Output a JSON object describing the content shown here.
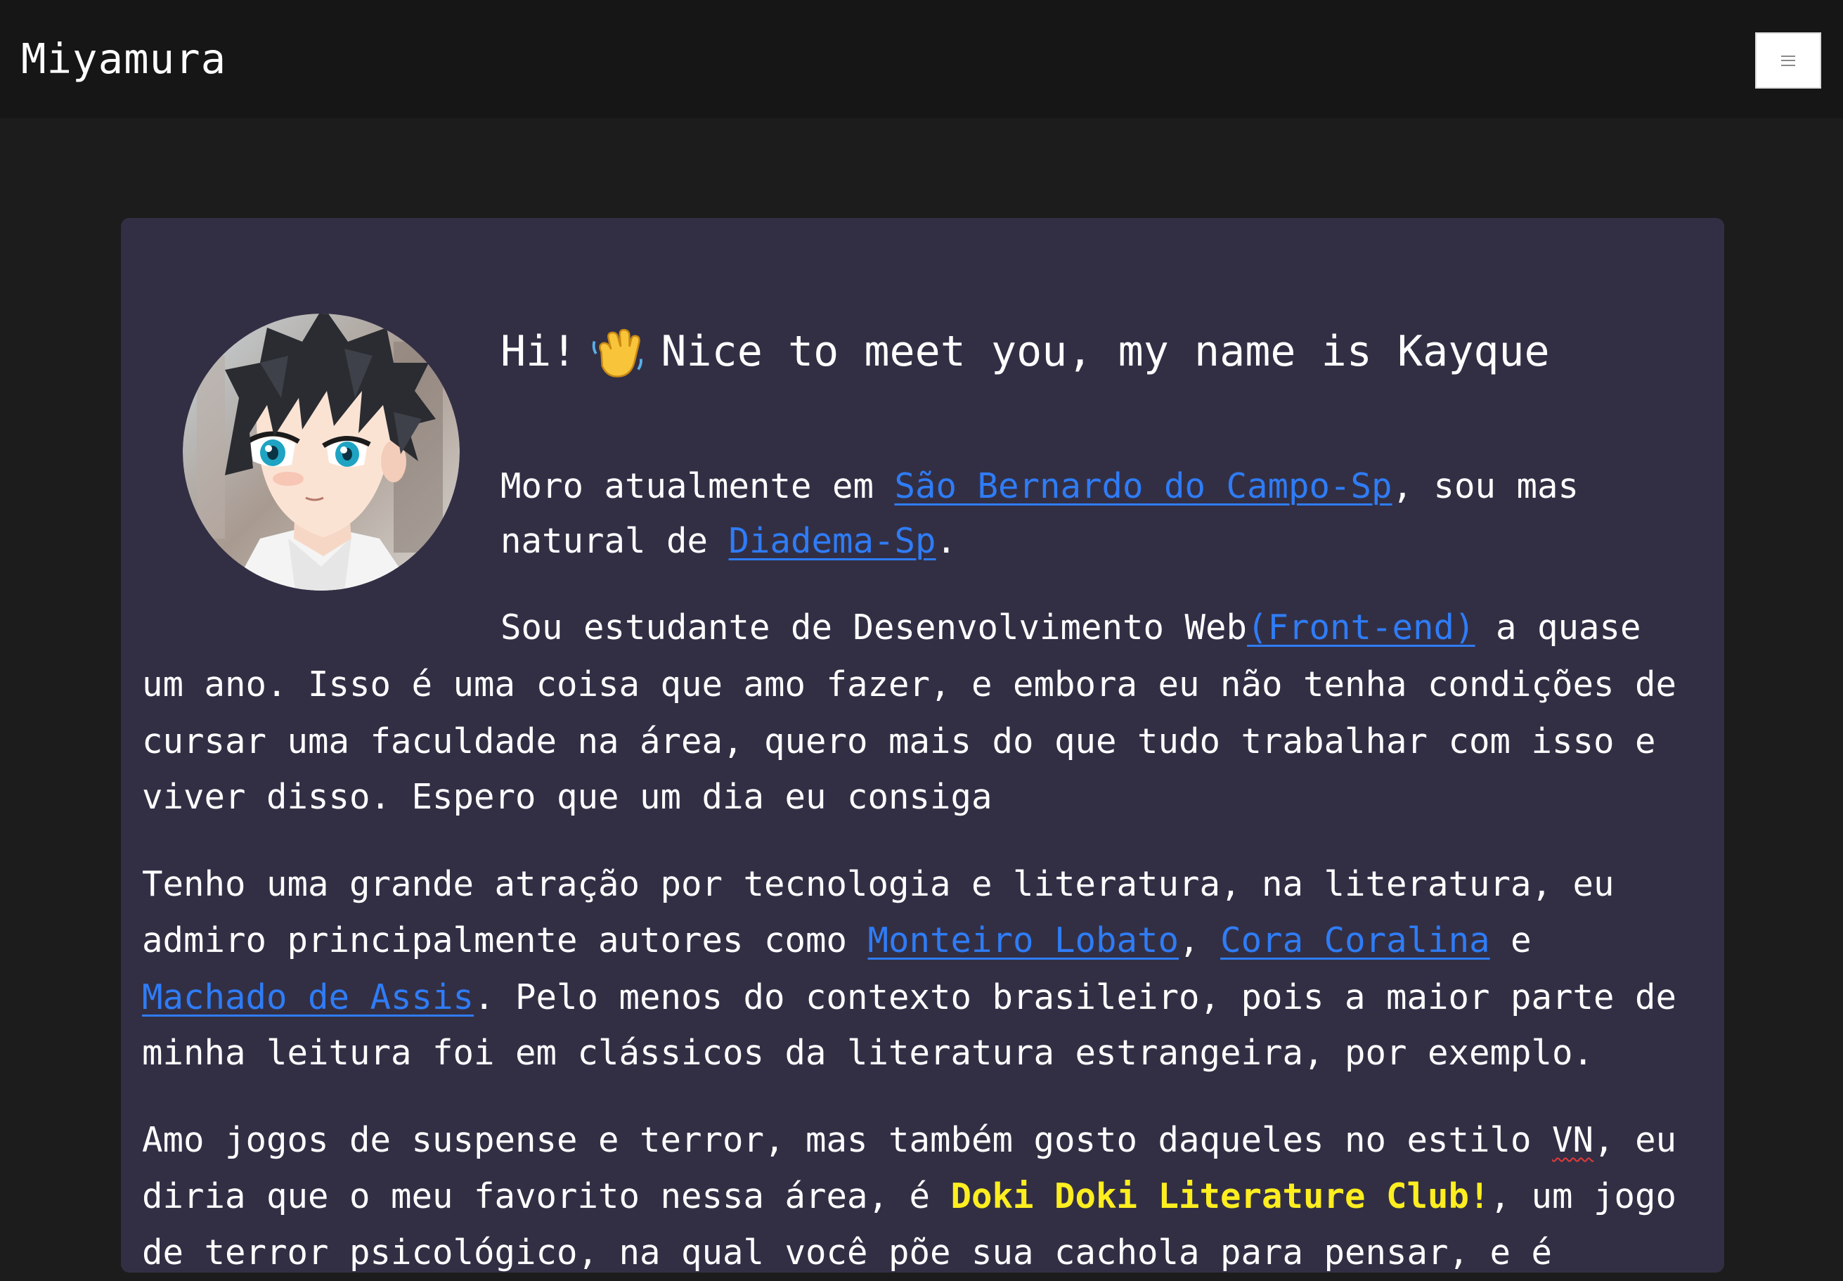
{
  "header": {
    "brand": "Miyamura",
    "menu_icon": "hamburger-icon"
  },
  "profile": {
    "avatar_icon": "anime-avatar",
    "greeting_pre": "Hi!",
    "greeting_emoji": "waving-hand-icon",
    "greeting_post": "Nice to meet you, my name is Kayque"
  },
  "intro": {
    "t1": "Moro atualmente em ",
    "link1": "São Bernardo do Campo-Sp",
    "t2": ", sou mas",
    "t3": "natural de ",
    "link2": "Diadema-Sp",
    "t4": "."
  },
  "study": {
    "t1": "Sou estudante de Desenvolvimento Web",
    "link": "(Front-end)",
    "t2": " a quase",
    "line2": "um ano. Isso é uma coisa que amo fazer, e embora eu não tenha condições de",
    "line3": "cursar uma faculdade na área, quero mais do que tudo trabalhar com isso e",
    "line4": "viver disso. Espero que um dia eu consiga"
  },
  "literature": {
    "line1": "Tenho uma grande atração por tecnologia e literatura, na literatura, eu",
    "t1": "admiro principalmente autores como ",
    "link1": "Monteiro Lobato",
    "t2": ", ",
    "link2": "Cora Coralina",
    "t3": " e",
    "link3": "Machado de Assis",
    "t4": ". Pelo menos do contexto brasileiro, pois a maior parte de",
    "line4": "minha leitura foi em clássicos da literatura estrangeira, por exemplo."
  },
  "games": {
    "t1": "Amo jogos de suspense e terror, mas também gosto daqueles no estilo ",
    "vn": "VN",
    "t2": ", eu",
    "t3": "diria que o meu favorito nessa área, é ",
    "game": "Doki Doki Literature Club!",
    "t4": ", um jogo",
    "line3": "de terror psicológico, na qual você põe sua cachola para pensar, e é"
  },
  "colors": {
    "link": "#2f7cf6",
    "highlight": "#ffee1f",
    "card_bg": "#322f45",
    "page_bg": "#1c1c1c",
    "navbar_bg": "#161616"
  }
}
